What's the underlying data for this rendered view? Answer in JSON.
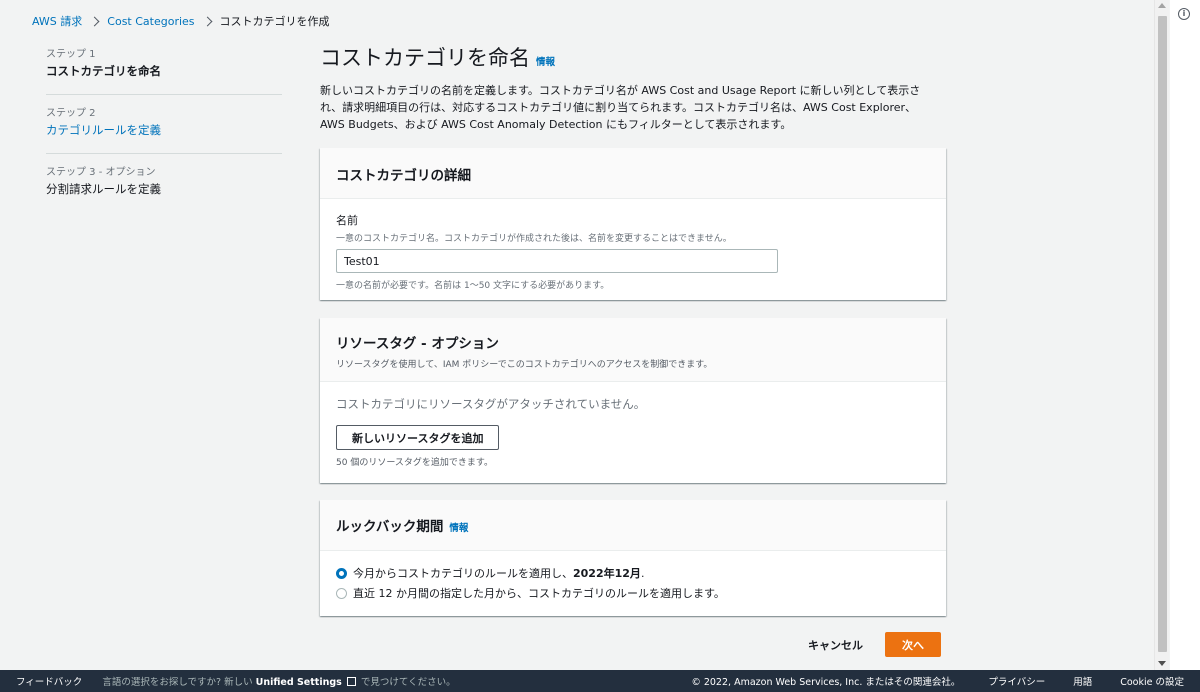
{
  "breadcrumb": {
    "items": [
      "AWS 請求",
      "Cost Categories"
    ],
    "current": "コストカテゴリを作成"
  },
  "steps": [
    {
      "num": "ステップ 1",
      "name": "コストカテゴリを命名"
    },
    {
      "num": "ステップ 2",
      "name": "カテゴリルールを定義"
    },
    {
      "num": "ステップ 3 - オプション",
      "name": "分割請求ルールを定義"
    }
  ],
  "page": {
    "title": "コストカテゴリを命名",
    "info": "情報",
    "description": "新しいコストカテゴリの名前を定義します。コストカテゴリ名が AWS Cost and Usage Report に新しい列として表示され、請求明細項目の行は、対応するコストカテゴリ値に割り当てられます。コストカテゴリ名は、AWS Cost Explorer、AWS Budgets、および AWS Cost Anomaly Detection にもフィルターとして表示されます。"
  },
  "details": {
    "header": "コストカテゴリの詳細",
    "name_label": "名前",
    "name_desc": "一意のコストカテゴリ名。コストカテゴリが作成された後は、名前を変更することはできません。",
    "name_value": "Test01",
    "name_constraint": "一意の名前が必要です。名前は 1～50 文字にする必要があります。"
  },
  "tags": {
    "header": "リソースタグ - オプション",
    "sub": "リソースタグを使用して、IAM ポリシーでこのコストカテゴリへのアクセスを制御できます。",
    "empty": "コストカテゴリにリソースタグがアタッチされていません。",
    "add_button": "新しいリソースタグを追加",
    "hint": "50 個のリソースタグを追加できます。"
  },
  "lookback": {
    "header": "ルックバック期間",
    "info": "情報",
    "option1_prefix": "今月からコストカテゴリのルールを適用し、",
    "option1_bold": "2022年12月",
    "option1_suffix": ".",
    "option2": "直近 12 か月間の指定した月から、コストカテゴリのルールを適用します。",
    "selected": "option1"
  },
  "actions": {
    "cancel": "キャンセル",
    "next": "次へ"
  },
  "footer": {
    "feedback": "フィードバック",
    "lang_prefix": "言語の選択をお探しですか? 新しい",
    "lang_link": "Unified Settings",
    "lang_suffix": "で見つけてください。",
    "copyright": "© 2022, Amazon Web Services, Inc. またはその関連会社。",
    "privacy": "プライバシー",
    "terms": "用語",
    "cookie": "Cookie の設定"
  },
  "colors": {
    "link": "#0073bb",
    "primary": "#ec7211",
    "footer_bg": "#232f3e"
  },
  "icons": [
    "chevron-right-icon",
    "info-circle-icon",
    "external-link-icon"
  ]
}
